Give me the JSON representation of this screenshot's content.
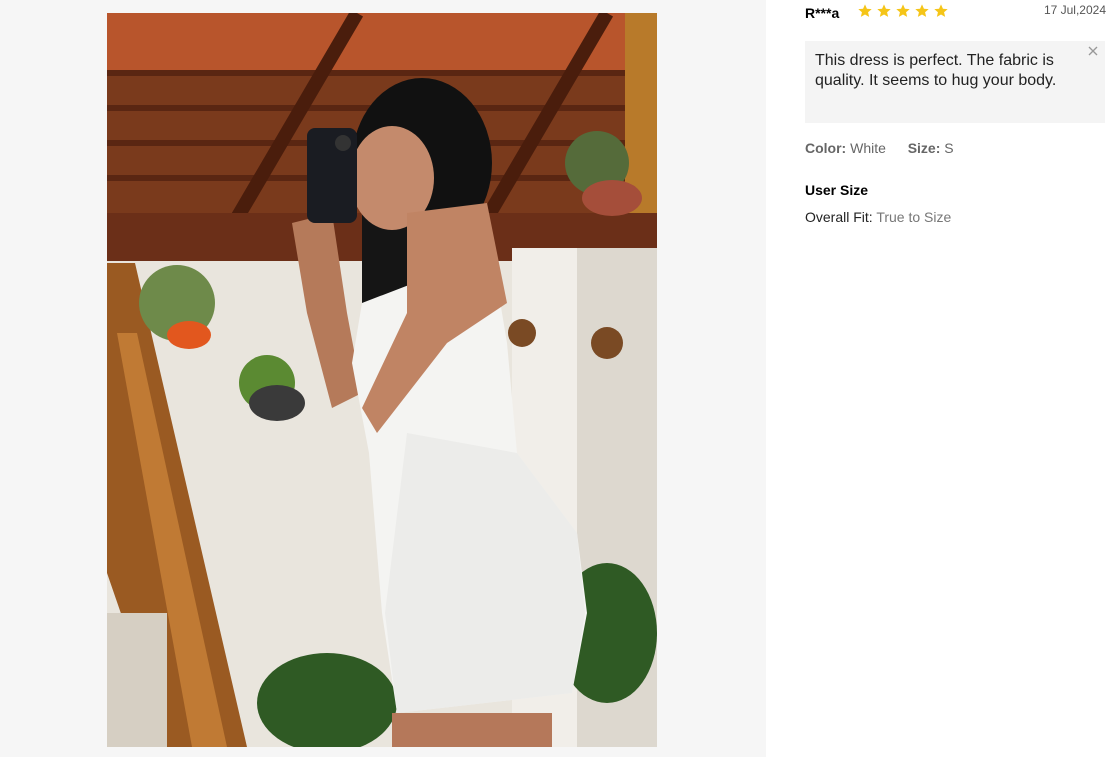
{
  "review": {
    "reviewer": "R***a",
    "rating": 5,
    "rating_max": 5,
    "date": "17 Jul,2024",
    "text": "This dress is perfect. The fabric is quality. It seems to hug your body.",
    "color_label": "Color:",
    "color_value": "White",
    "size_label": "Size:",
    "size_value": "S",
    "user_size_title": "User Size",
    "overall_fit_label": "Overall Fit:",
    "overall_fit_value": "True to Size"
  },
  "icons": {
    "star": "star-icon",
    "close": "close-icon"
  },
  "colors": {
    "star": "#f5c518",
    "bubble_bg": "#f4f4f4",
    "photo_pane_bg": "#f6f6f6"
  }
}
